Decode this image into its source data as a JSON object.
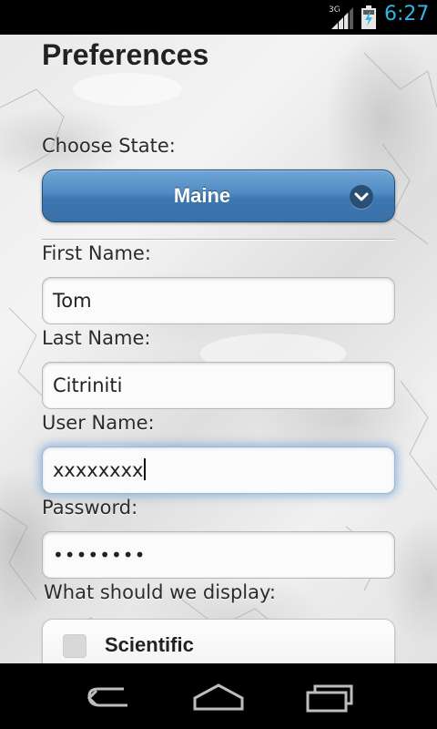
{
  "status_bar": {
    "network_type": "3G",
    "signal_icon": "signal-icon",
    "battery_icon": "battery-charging-icon",
    "time": "6:27",
    "time_color": "#33b5e5"
  },
  "page": {
    "title": "Preferences"
  },
  "state": {
    "label": "Choose State:",
    "selected": "Maine",
    "icon": "chevron-down-icon",
    "button_color": "#3d77b1"
  },
  "form": {
    "first_name": {
      "label": "First Name:",
      "value": "Tom"
    },
    "last_name": {
      "label": "Last Name:",
      "value": "Citriniti"
    },
    "user_name": {
      "label": "User Name:",
      "value": "xxxxxxxx"
    },
    "password": {
      "label": "Password:",
      "value": "••••••••"
    }
  },
  "display": {
    "label": "What should we display:",
    "options": [
      {
        "label": "Scientific",
        "checked": false
      }
    ]
  },
  "nav_bar": {
    "back_icon": "back-icon",
    "home_icon": "home-icon",
    "recents_icon": "recent-apps-icon"
  }
}
